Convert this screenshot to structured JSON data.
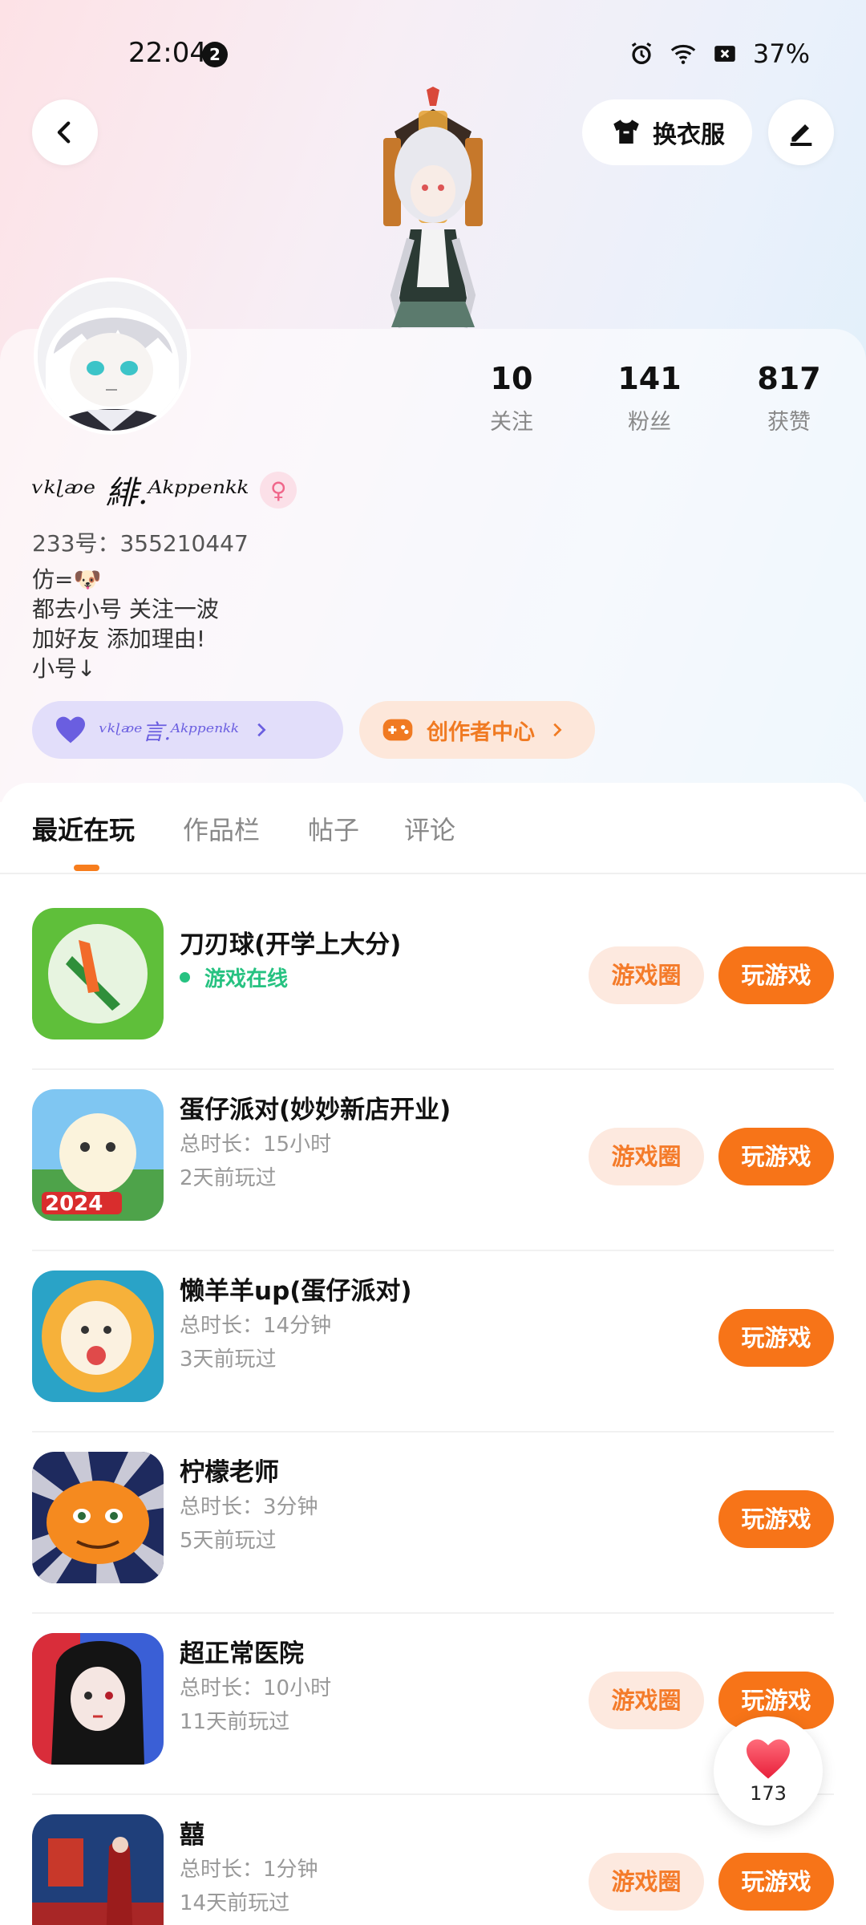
{
  "status_bar": {
    "time": "22:04",
    "notification_count": "2",
    "battery": "37%"
  },
  "header": {
    "outfit_label": "换衣服"
  },
  "profile": {
    "stats": [
      {
        "value": "10",
        "label": "关注"
      },
      {
        "value": "141",
        "label": "粉丝"
      },
      {
        "value": "817",
        "label": "获赞"
      }
    ],
    "nickname": "ᵛᵏᶩᵆᵉ 緋.ᴬᵏᵖᵖᵉⁿᵏᵏ",
    "gender_symbol": "♀",
    "uid": "233号：355210447",
    "bio": [
      "仿=🐶",
      "都去小号 关注一波",
      "加好友 添加理由!",
      "小号↓"
    ],
    "friend_pill": "ᵛᵏᶩᵆᵉ言.ᴬᵏᵖᵖᵉⁿᵏᵏ",
    "creator_pill": "创作者中心"
  },
  "tabs": [
    "最近在玩",
    "作品栏",
    "帖子",
    "评论"
  ],
  "games": [
    {
      "title": "刀刃球(开学上大分)",
      "online": "游戏在线",
      "circle_label": "游戏圈",
      "play_label": "玩游戏"
    },
    {
      "title": "蛋仔派对(妙妙新店开业)",
      "duration": "总时长：15小时",
      "last_played": "2天前玩过",
      "circle_label": "游戏圈",
      "play_label": "玩游戏"
    },
    {
      "title": "懒羊羊up(蛋仔派对)",
      "duration": "总时长：14分钟",
      "last_played": "3天前玩过",
      "play_label": "玩游戏"
    },
    {
      "title": "柠檬老师",
      "duration": "总时长：3分钟",
      "last_played": "5天前玩过",
      "play_label": "玩游戏"
    },
    {
      "title": "超正常医院",
      "duration": "总时长：10小时",
      "last_played": "11天前玩过",
      "circle_label": "游戏圈",
      "play_label": "玩游戏"
    },
    {
      "title": "囍",
      "duration": "总时长：1分钟",
      "last_played": "14天前玩过",
      "circle_label": "游戏圈",
      "play_label": "玩游戏"
    }
  ],
  "like_bubble": {
    "count": "173"
  },
  "colors": {
    "accent": "#f77418",
    "online": "#26c281"
  }
}
